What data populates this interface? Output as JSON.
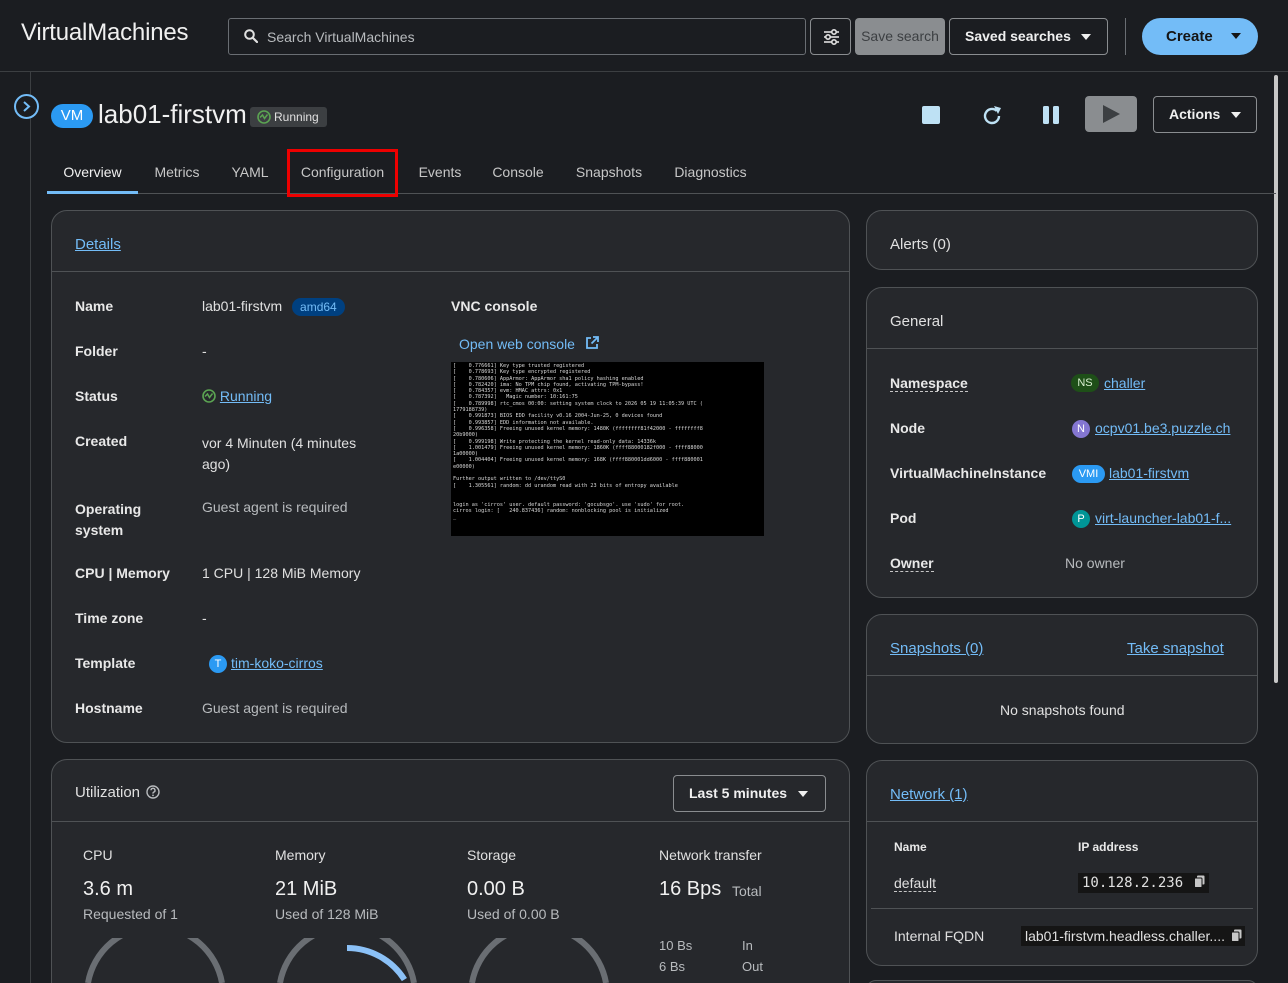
{
  "masthead": {
    "title": "VirtualMachines",
    "search_placeholder": "Search VirtualMachines",
    "save_search": "Save search",
    "saved_searches": "Saved searches",
    "create": "Create"
  },
  "header": {
    "badge": "VM",
    "title": "lab01-firstvm",
    "status": "Running",
    "actions": "Actions"
  },
  "tabs": [
    "Overview",
    "Metrics",
    "YAML",
    "Configuration",
    "Events",
    "Console",
    "Snapshots",
    "Diagnostics"
  ],
  "details": {
    "title": "Details",
    "name_label": "Name",
    "name_value": "lab01-firstvm",
    "arch": "amd64",
    "folder_label": "Folder",
    "folder_value": "-",
    "status_label": "Status",
    "status_value": "Running",
    "created_label": "Created",
    "created_value_1": "vor 4 Minuten (4 minutes",
    "created_value_2": "ago)",
    "os_label_1": "Operating",
    "os_label_2": "system",
    "os_value": "Guest agent is required",
    "cpu_label": "CPU | Memory",
    "cpu_value": "1 CPU | 128 MiB Memory",
    "tz_label": "Time zone",
    "tz_value": "-",
    "template_label": "Template",
    "template_icon": "T",
    "template_value": "tim-koko-cirros",
    "hostname_label": "Hostname",
    "hostname_value": "Guest agent is required",
    "vnc_title": "VNC console",
    "open_console": "Open web console"
  },
  "alerts": {
    "title": "Alerts (0)"
  },
  "general": {
    "title": "General",
    "namespace_label": "Namespace",
    "namespace_icon": "NS",
    "namespace_value": "challer",
    "node_label": "Node",
    "node_icon": "N",
    "node_value": "ocpv01.be3.puzzle.ch",
    "vmi_label": "VirtualMachineInstance",
    "vmi_icon": "VMI",
    "vmi_value": "lab01-firstvm",
    "pod_label": "Pod",
    "pod_icon": "P",
    "pod_value": "virt-launcher-lab01-f...",
    "owner_label": "Owner",
    "owner_value": "No owner"
  },
  "snapshots": {
    "title": "Snapshots (0)",
    "take": "Take snapshot",
    "empty": "No snapshots found"
  },
  "network": {
    "title": "Network (1)",
    "col_name": "Name",
    "col_ip": "IP address",
    "row_name": "default",
    "row_ip": "10.128.2.236",
    "fqdn_label": "Internal FQDN",
    "fqdn_value": "lab01-firstvm.headless.challer...."
  },
  "utilization": {
    "title": "Utilization",
    "range": "Last 5 minutes",
    "cpu_label": "CPU",
    "cpu_value": "3.6 m",
    "cpu_sub": "Requested of 1",
    "mem_label": "Memory",
    "mem_value": "21 MiB",
    "mem_sub": "Used of 128 MiB",
    "storage_label": "Storage",
    "storage_value": "0.00 B",
    "storage_sub": "Used of 0.00 B",
    "net_label": "Network transfer",
    "net_value": "16 Bps",
    "net_total": "Total",
    "net_in_value": "10 Bs",
    "net_in_label": "In",
    "net_out_value": "6 Bs",
    "net_out_label": "Out",
    "memory_used_fraction": 0.16
  },
  "console_text": "[    0.776661] Key type trusted registered\n[    0.778693] Key type encrypted registered\n[    0.780606] AppArmor: AppArmor sha1 policy hashing enabled\n[    0.782420] ima: No TPM chip found, activating TPM-bypass!\n[    0.784357] evm: HMAC attrs: 0x1\n[    0.787392]   Magic number: 10:161:75\n[    0.789998] rtc_cmos 00:00: setting system clock to 2026 05 19 11:05:39 UTC (\n1779188739)\n[    0.991873] BIOS EDD facility v0.16 2004-Jun-25, 0 devices found\n[    0.993857] EDD information not available.\n[    0.996358] Freeing unused kernel memory: 1480K (ffffffff81f42000 - ffffffff8\n20b9000)\n[    0.999198] Write protecting the kernel read-only data: 14336k\n[    1.001479] Freeing unused kernel memory: 1860K (ffff88000182f000 - ffff88000\n1a00000)\n[    1.004404] Freeing unused kernel memory: 168K (ffff880001dd6000 - ffff880001\ne00000)\n\nFurther output written to /dev/ttyS0\n[    1.305561] random: dd urandom read with 23 bits of entropy available\n\n\nlogin as 'cirros' user. default password: 'gocubsgo'. use 'sudo' for root.\ncirros login: [   240.837436] random: nonblocking pool is initialized\n_"
}
